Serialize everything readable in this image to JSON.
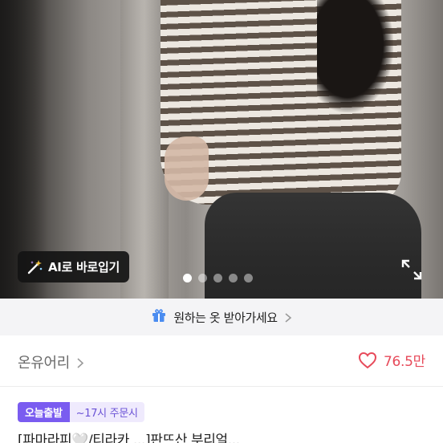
{
  "photo": {
    "ai_button_label": "AI로 바로입기",
    "ai_icon": "magic-wand-icon",
    "expand_icon": "expand-icon",
    "carousel": {
      "total": 5,
      "active_index": 0
    }
  },
  "banner": {
    "icon": "gift-icon",
    "label": "원하는 옷 받아가세요"
  },
  "seller": {
    "name": "온유어리",
    "likes_count": "76.5만",
    "heart_color": "#e74a5a"
  },
  "badges": {
    "main": "오늘출발",
    "sub": "~17시 주문시"
  },
  "product": {
    "title_partial": "[파마라피🤍/티라카 ...]판뜨산 부리얼..."
  },
  "colors": {
    "accent": "#7a5cf0",
    "banner_bg": "#f4f4f6"
  }
}
